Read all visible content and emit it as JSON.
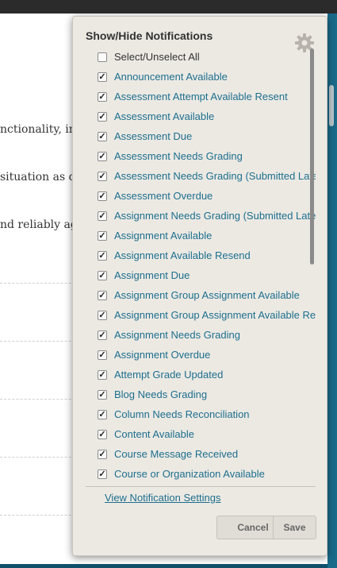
{
  "page": {
    "line1": "nctionality, in",
    "line2": "situation as q",
    "line3": "nd reliably ag"
  },
  "panel": {
    "title": "Show/Hide Notifications",
    "select_all": {
      "label": "Select/Unselect All",
      "checked": false
    },
    "items": [
      {
        "label": "Announcement Available",
        "checked": true
      },
      {
        "label": "Assessment Attempt Available Resent",
        "checked": true
      },
      {
        "label": "Assessment Available",
        "checked": true
      },
      {
        "label": "Assessment Due",
        "checked": true
      },
      {
        "label": "Assessment Needs Grading",
        "checked": true
      },
      {
        "label": "Assessment Needs Grading (Submitted Late",
        "checked": true
      },
      {
        "label": "Assessment Overdue",
        "checked": true
      },
      {
        "label": "Assignment Needs Grading (Submitted Late",
        "checked": true
      },
      {
        "label": "Assignment Available",
        "checked": true
      },
      {
        "label": "Assignment Available Resend",
        "checked": true
      },
      {
        "label": "Assignment Due",
        "checked": true
      },
      {
        "label": "Assignment Group Assignment Available",
        "checked": true
      },
      {
        "label": "Assignment Group Assignment Available Re",
        "checked": true
      },
      {
        "label": "Assignment Needs Grading",
        "checked": true
      },
      {
        "label": "Assignment Overdue",
        "checked": true
      },
      {
        "label": "Attempt Grade Updated",
        "checked": true
      },
      {
        "label": "Blog Needs Grading",
        "checked": true
      },
      {
        "label": "Column Needs Reconciliation",
        "checked": true
      },
      {
        "label": "Content Available",
        "checked": true
      },
      {
        "label": "Course Message Received",
        "checked": true
      },
      {
        "label": "Course or Organization Available",
        "checked": true
      }
    ],
    "settings_link": "View Notification Settings",
    "cancel_label": "Cancel",
    "save_label": "Save"
  },
  "colors": {
    "link": "#1d6f8e",
    "panel_bg": "#ece9e3",
    "accent": "#1f5f79"
  }
}
